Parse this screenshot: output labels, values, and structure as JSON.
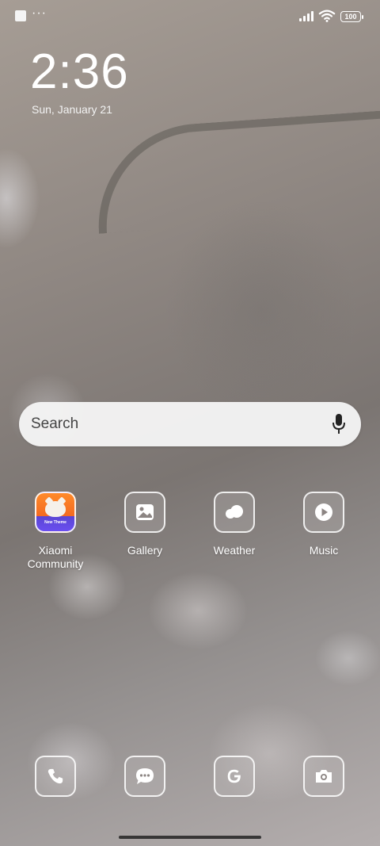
{
  "status_bar": {
    "battery": "100",
    "overflow": "···"
  },
  "lock": {
    "time": "2:36",
    "date": "Sun, January 21"
  },
  "search": {
    "placeholder": "Search"
  },
  "apps": [
    {
      "label": "Xiaomi\nCommunity",
      "icon": "xiaomi-community-icon",
      "badge": "New Theme"
    },
    {
      "label": "Gallery",
      "icon": "gallery-icon"
    },
    {
      "label": "Weather",
      "icon": "weather-icon"
    },
    {
      "label": "Music",
      "icon": "music-icon"
    }
  ],
  "dock": [
    {
      "icon": "phone-icon"
    },
    {
      "icon": "messages-icon"
    },
    {
      "icon": "google-icon"
    },
    {
      "icon": "camera-icon"
    }
  ],
  "colors": {
    "community_orange": "#f36b21",
    "community_purple": "#6a4ef0"
  }
}
